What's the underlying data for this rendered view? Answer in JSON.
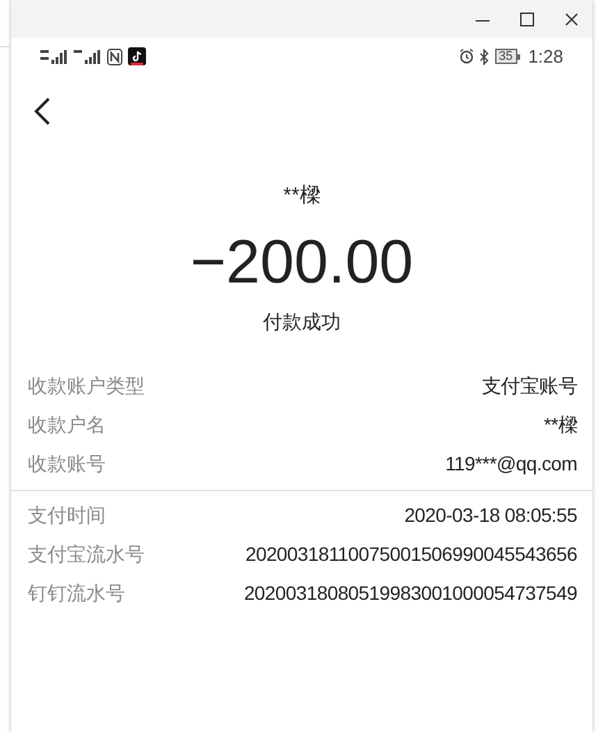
{
  "status_bar": {
    "battery": "35",
    "time": "1:28"
  },
  "payee": "**樑",
  "amount": "−200.00",
  "result": "付款成功",
  "groups": [
    [
      {
        "label": "收款账户类型",
        "value": "支付宝账号"
      },
      {
        "label": "收款户名",
        "value": "**樑"
      },
      {
        "label": "收款账号",
        "value": "119***@qq.com"
      }
    ],
    [
      {
        "label": "支付时间",
        "value": "2020-03-18 08:05:55"
      },
      {
        "label": "支付宝流水号",
        "value": "20200318110075001506990045543656"
      },
      {
        "label": "钉钉流水号",
        "value": "20200318080519983001000054737549"
      }
    ]
  ]
}
